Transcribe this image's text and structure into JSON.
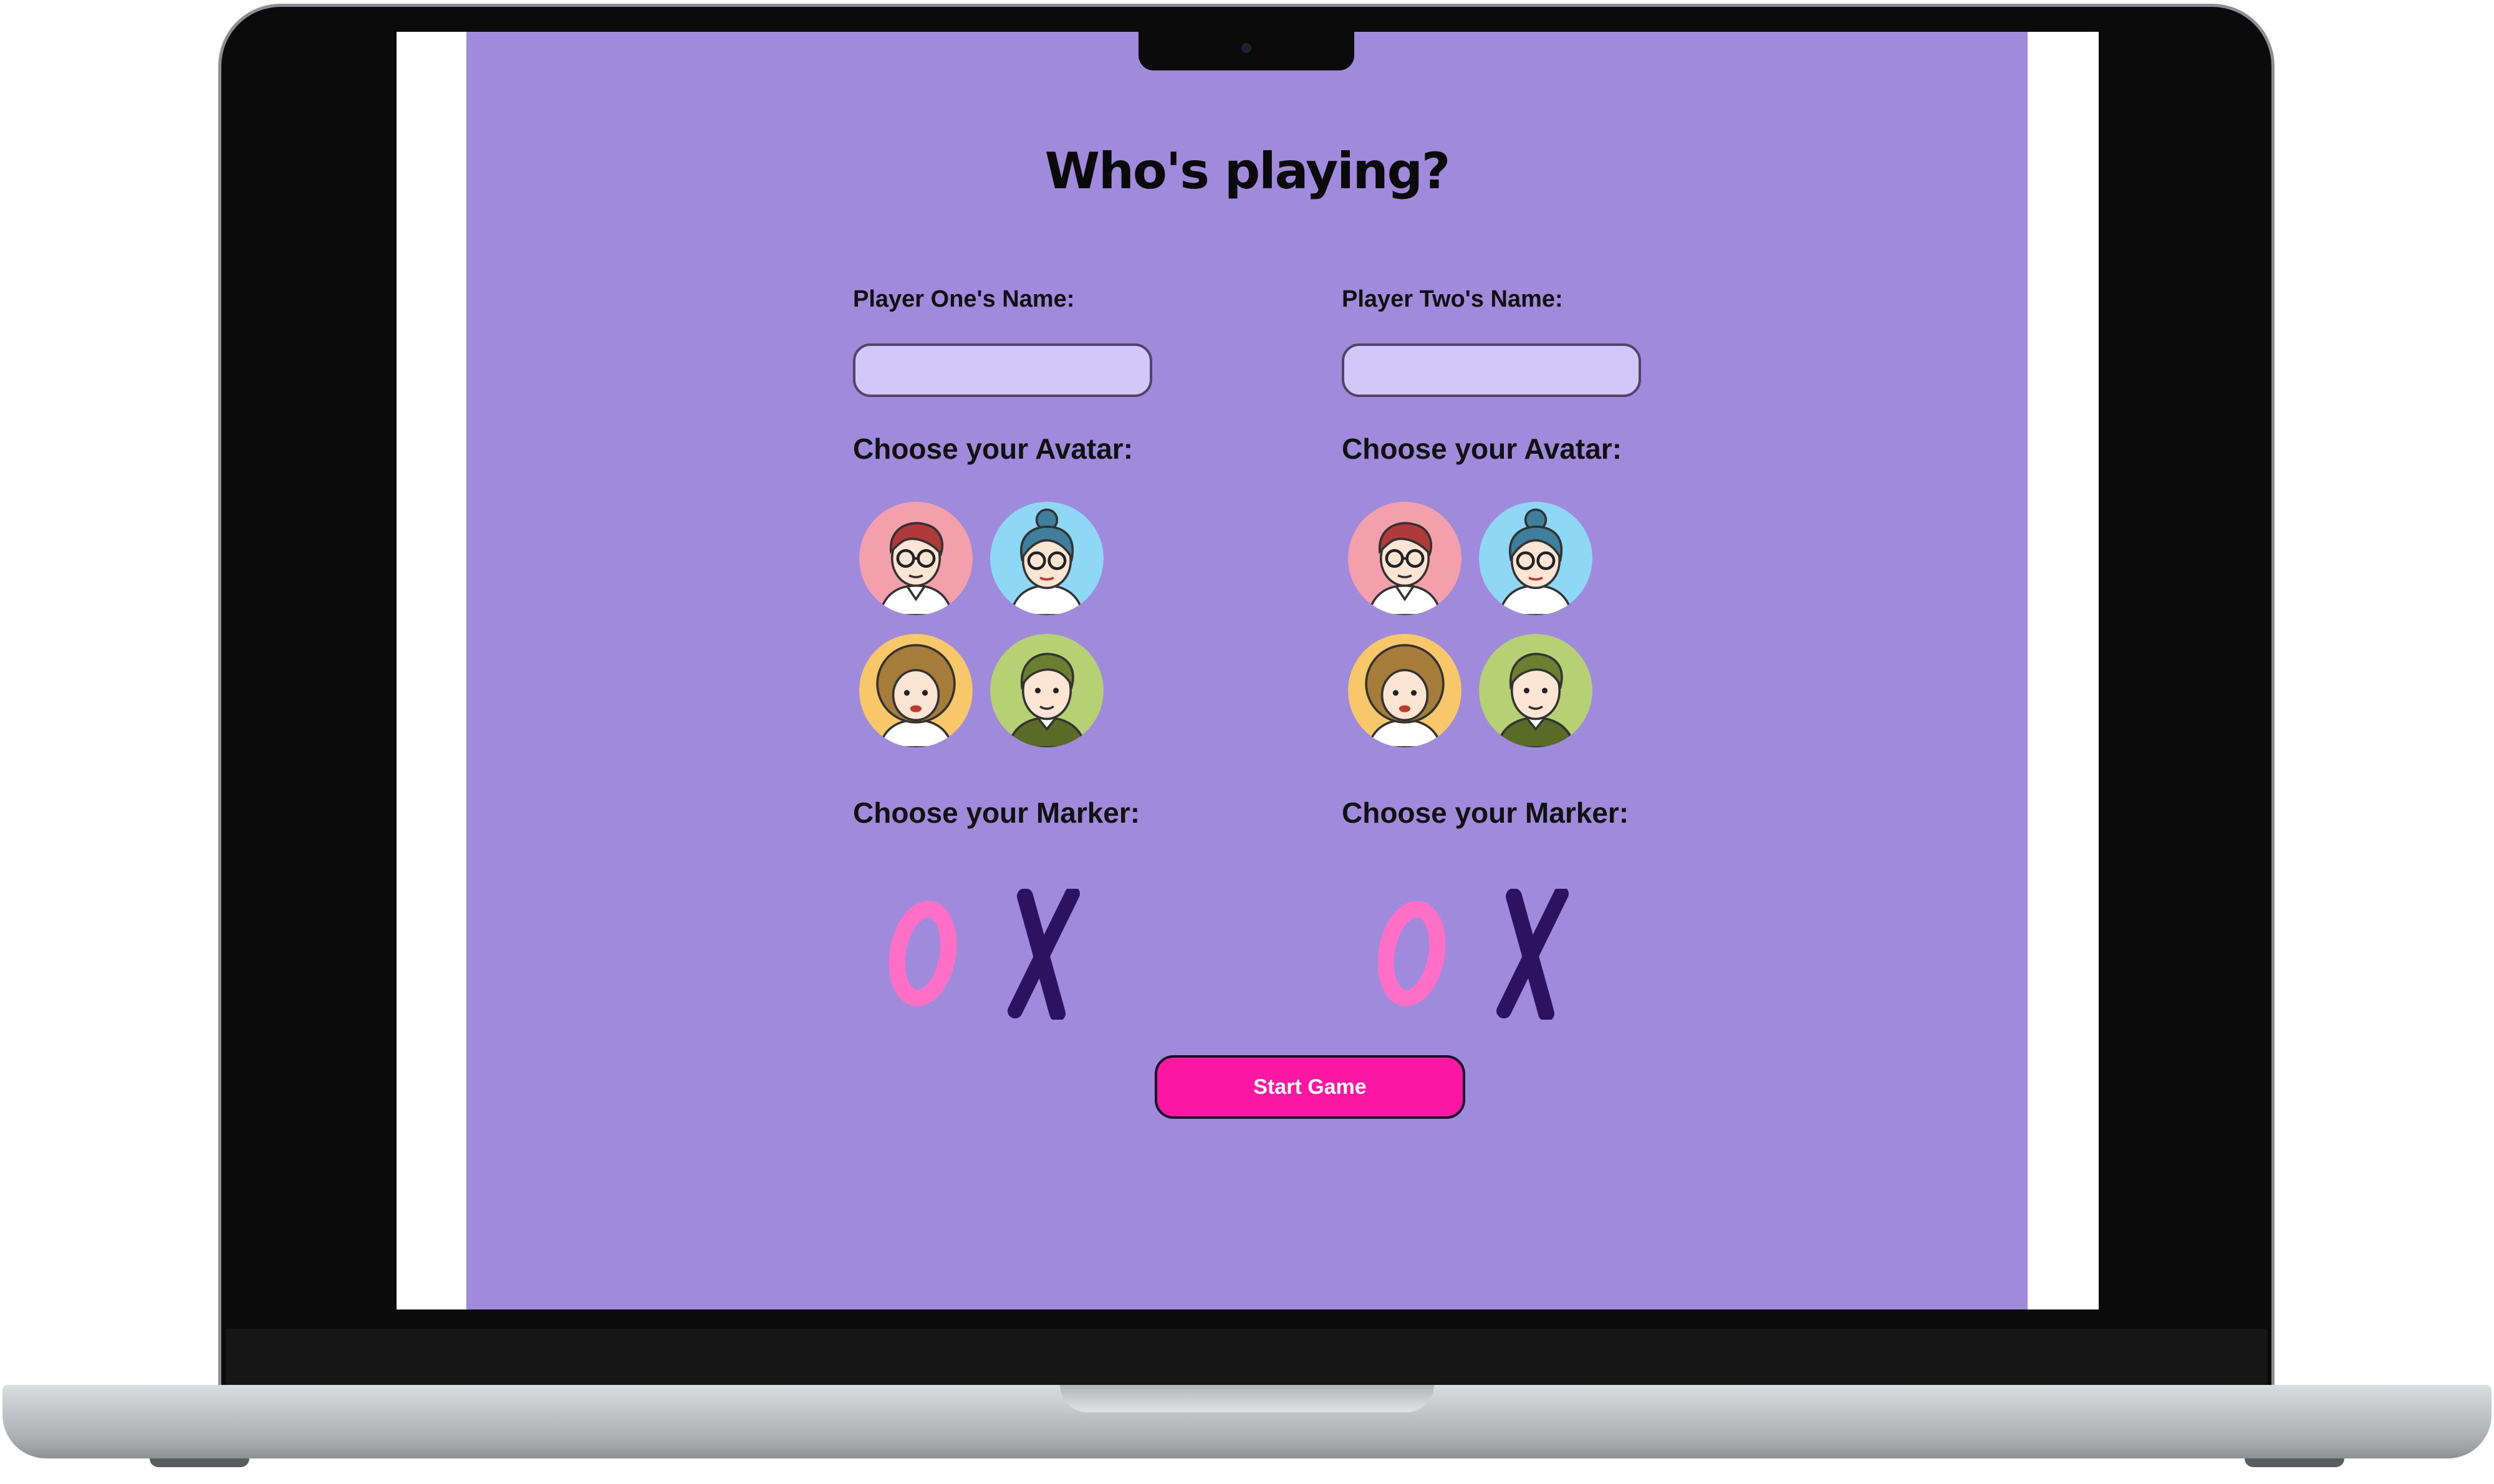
{
  "page": {
    "title": "Who's playing?",
    "background_color": "#a08adc",
    "accent_color": "#fb17a4"
  },
  "players": [
    {
      "name_label": "Player One's Name:",
      "name_value": "",
      "avatar_label": "Choose your Avatar:",
      "avatars": [
        "man-with-glasses-avatar",
        "woman-with-bun-avatar",
        "curly-haired-woman-avatar",
        "green-shirt-man-avatar"
      ],
      "marker_label": "Choose your Marker:",
      "markers": [
        "O",
        "X"
      ]
    },
    {
      "name_label": "Player Two's Name:",
      "name_value": "",
      "avatar_label": "Choose your Avatar:",
      "avatars": [
        "man-with-glasses-avatar",
        "woman-with-bun-avatar",
        "curly-haired-woman-avatar",
        "green-shirt-man-avatar"
      ],
      "marker_label": "Choose your Marker:",
      "markers": [
        "O",
        "X"
      ]
    }
  ],
  "start_button": {
    "label": "Start Game"
  },
  "colors": {
    "avatar_backgrounds": [
      "#f4a0ac",
      "#8ed8f5",
      "#f8c76a",
      "#b6d174"
    ],
    "marker_o": "#ff6fc6",
    "marker_x": "#2c1260"
  }
}
